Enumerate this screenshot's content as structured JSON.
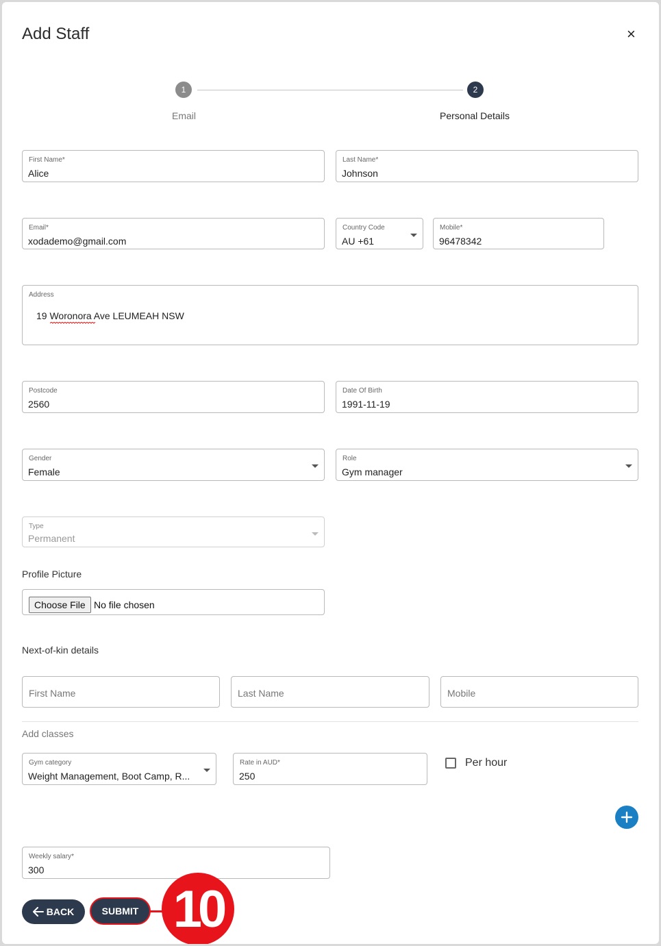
{
  "dialog": {
    "title": "Add Staff",
    "close_glyph": "×"
  },
  "stepper": {
    "steps": [
      {
        "number": "1",
        "label": "Email",
        "state": "completed",
        "color": "#8c8c8c"
      },
      {
        "number": "2",
        "label": "Personal Details",
        "state": "active",
        "color": "#2d3a4e"
      }
    ]
  },
  "form": {
    "first_name": {
      "label": "First Name",
      "required": "*",
      "value": "Alice"
    },
    "last_name": {
      "label": "Last Name",
      "required": "*",
      "value": "Johnson"
    },
    "email": {
      "label": "Email",
      "required": "*",
      "value": "xodademo@gmail.com"
    },
    "country_code": {
      "label": "Country Code",
      "value": "AU +61"
    },
    "mobile": {
      "label": "Mobile",
      "required": "*",
      "value": "96478342"
    },
    "address": {
      "label": "Address",
      "value": "19 Woronora Ave LEUMEAH NSW"
    },
    "postcode": {
      "label": "Postcode",
      "value": "2560"
    },
    "dob": {
      "label": "Date Of Birth",
      "value": "1991-11-19"
    },
    "gender": {
      "label": "Gender",
      "value": "Female"
    },
    "role": {
      "label": "Role",
      "value": "Gym manager"
    },
    "type": {
      "label": "Type",
      "value": "Permanent"
    },
    "profile_picture": {
      "title": "Profile Picture",
      "button": "Choose File",
      "status": "No file chosen"
    },
    "next_of_kin": {
      "title": "Next-of-kin details",
      "first_name_placeholder": "First Name",
      "last_name_placeholder": "Last Name",
      "mobile_placeholder": "Mobile"
    },
    "classes": {
      "title": "Add classes",
      "gym_category": {
        "label": "Gym category",
        "value": "Weight Management, Boot Camp, R..."
      },
      "rate": {
        "label": "Rate in AUD",
        "required": "*",
        "value": "250"
      },
      "per_hour": {
        "label": "Per hour",
        "checked": false
      }
    },
    "weekly_salary": {
      "label": "Weekly salary",
      "required": "*",
      "value": "300"
    }
  },
  "actions": {
    "back": "BACK",
    "submit": "SUBMIT"
  },
  "annotation": {
    "step_number": "10",
    "color": "#e8141b"
  },
  "colors": {
    "primary": "#2d3a4e",
    "accent_blue": "#1b7fc4",
    "highlight": "#e8141b"
  }
}
